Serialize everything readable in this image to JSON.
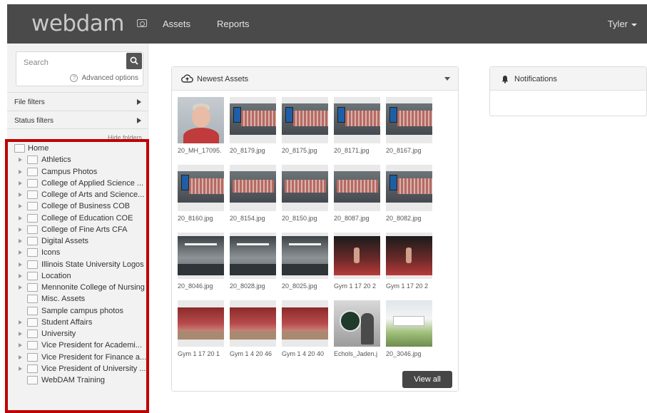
{
  "header": {
    "logo": "webdam",
    "nav": [
      "Assets",
      "Reports"
    ],
    "user": "Tyler"
  },
  "sidebar": {
    "search_placeholder": "Search",
    "advanced_options": "Advanced options",
    "file_filters": "File filters",
    "status_filters": "Status filters",
    "hide_folders": "Hide folders",
    "tree": [
      {
        "label": "Home",
        "expander": false,
        "level": 0
      },
      {
        "label": "Athletics",
        "expander": true,
        "level": 1
      },
      {
        "label": "Campus Photos",
        "expander": true,
        "level": 1
      },
      {
        "label": "College of Applied Science ...",
        "expander": true,
        "level": 1
      },
      {
        "label": "College of Arts and Science...",
        "expander": true,
        "level": 1
      },
      {
        "label": "College of Business COB",
        "expander": true,
        "level": 1
      },
      {
        "label": "College of Education COE",
        "expander": true,
        "level": 1
      },
      {
        "label": "College of Fine Arts CFA",
        "expander": true,
        "level": 1
      },
      {
        "label": "Digital Assets",
        "expander": true,
        "level": 1
      },
      {
        "label": "Icons",
        "expander": true,
        "level": 1
      },
      {
        "label": "Illinois State University Logos",
        "expander": true,
        "level": 1
      },
      {
        "label": "Location",
        "expander": true,
        "level": 1
      },
      {
        "label": "Mennonite College of Nursing",
        "expander": true,
        "level": 1
      },
      {
        "label": "Misc. Assets",
        "expander": false,
        "level": 1
      },
      {
        "label": "Sample campus photos",
        "expander": false,
        "level": 1
      },
      {
        "label": "Student Affairs",
        "expander": true,
        "level": 1
      },
      {
        "label": "University",
        "expander": true,
        "level": 1
      },
      {
        "label": "Vice President for Academi...",
        "expander": true,
        "level": 1
      },
      {
        "label": "Vice President for Finance a...",
        "expander": true,
        "level": 1
      },
      {
        "label": "Vice President of University ...",
        "expander": true,
        "level": 1
      },
      {
        "label": "WebDAM Training",
        "expander": false,
        "level": 1
      }
    ]
  },
  "newest_assets": {
    "title": "Newest Assets",
    "view_all": "View all",
    "items": [
      {
        "caption": "20_MH_17095.",
        "art": "portrait"
      },
      {
        "caption": "20_8179.jpg",
        "art": "wall"
      },
      {
        "caption": "20_8175.jpg",
        "art": "wall"
      },
      {
        "caption": "20_8171.jpg",
        "art": "wall"
      },
      {
        "caption": "20_8167.jpg",
        "art": "wall"
      },
      {
        "caption": "20_8160.jpg",
        "art": "wall"
      },
      {
        "caption": "20_8154.jpg",
        "art": "wall2"
      },
      {
        "caption": "20_8150.jpg",
        "art": "wall2"
      },
      {
        "caption": "20_8087.jpg",
        "art": "wall2"
      },
      {
        "caption": "20_8082.jpg",
        "art": "wall"
      },
      {
        "caption": "20_8046.jpg",
        "art": "corridor"
      },
      {
        "caption": "20_8028.jpg",
        "art": "corridor"
      },
      {
        "caption": "20_8025.jpg",
        "art": "corridor"
      },
      {
        "caption": "Gym 1 17 20 2",
        "art": "gym"
      },
      {
        "caption": "Gym 1 17 20 2",
        "art": "gym"
      },
      {
        "caption": "Gym 1 17 20 1",
        "art": "crowd"
      },
      {
        "caption": "Gym 1 4 20 46",
        "art": "crowd"
      },
      {
        "caption": "Gym 1 4 20 40",
        "art": "crowd"
      },
      {
        "caption": "Echols_Jaden.j",
        "art": "echols"
      },
      {
        "caption": "20_3046.jpg",
        "art": "outdoor"
      }
    ]
  },
  "notifications": {
    "title": "Notifications"
  }
}
